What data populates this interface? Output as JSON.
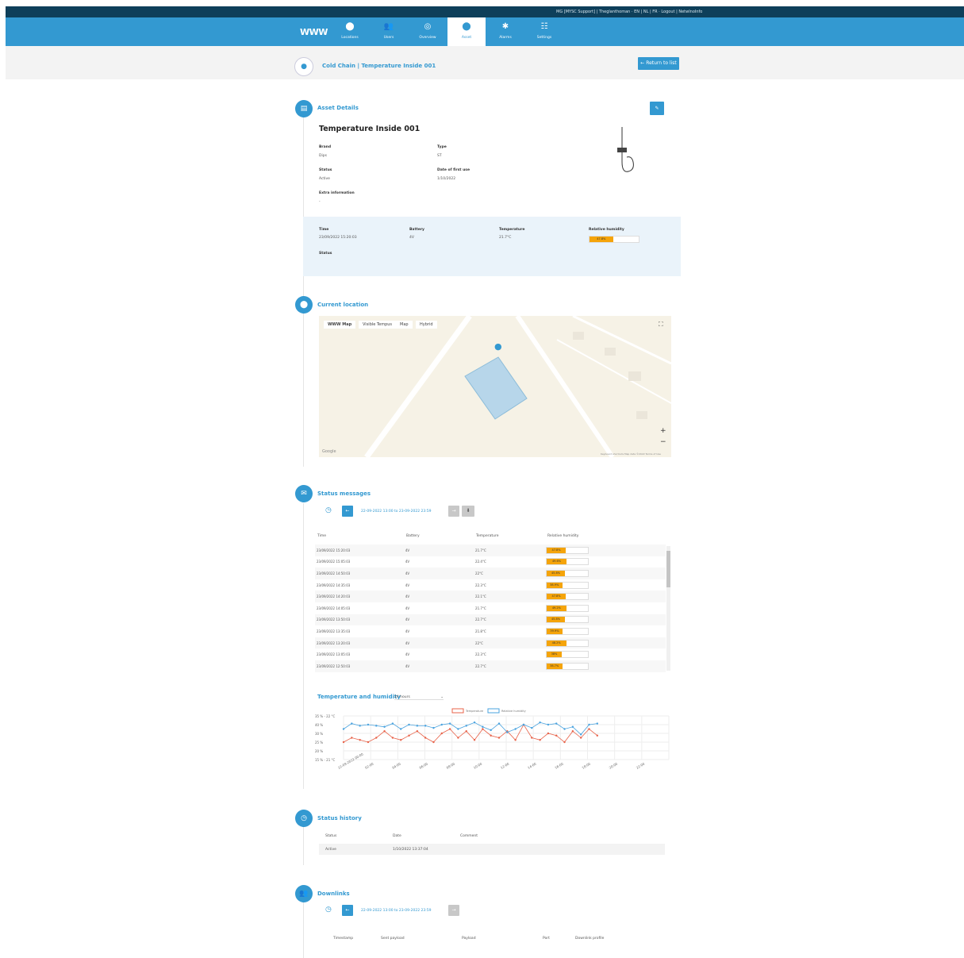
{
  "topbar": {
    "user_text": "MG [MYSC Support] | Theglanthoman · EN | NL | FR · Logout | NetwInoInfo"
  },
  "nav": {
    "logo": "WWW",
    "items": [
      {
        "label": "Locations",
        "icon": "map-pin-icon"
      },
      {
        "label": "Users",
        "icon": "users-icon"
      },
      {
        "label": "Overview",
        "icon": "eye-icon"
      },
      {
        "label": "Asset",
        "icon": "asset-pin-icon",
        "active": true
      },
      {
        "label": "Alarms",
        "icon": "alarm-icon"
      },
      {
        "label": "Settings",
        "icon": "settings-icon"
      }
    ]
  },
  "title": {
    "text": "Cold Chain | Temperature Inside 001",
    "return_label": "Return to list"
  },
  "asset_details": {
    "section_title": "Asset Details",
    "name": "Temperature Inside 001",
    "brand_label": "Brand",
    "brand_value": "Dips",
    "type_label": "Type",
    "type_value": "ST",
    "status_label": "Status",
    "status_value": "Active",
    "last_status_label": "Date of first use",
    "last_status_value": "1/10/2022",
    "extra_label": "Extra information",
    "extra_value": "-",
    "latest": {
      "time_label": "Time",
      "time_value": "23/09/2022 15:20:03",
      "battery_label": "Battery",
      "battery_value": "4V",
      "temp_label": "Temperature",
      "temp_value": "21.7°C",
      "humidity_label": "Relative humidity",
      "humidity_value": "47.8%",
      "humidity_fraction": 0.478,
      "status_label": "Status"
    }
  },
  "location": {
    "section_title": "Current location",
    "tabs": [
      "WWW Map",
      "Visible Tempus",
      "Map",
      "Hybrid"
    ],
    "google_label": "Google",
    "footer_text": "Keyboard shortcuts  Map data ©2022  Terms of Use"
  },
  "status_messages": {
    "section_title": "Status messages",
    "date_range": "22-09-2022 13:00 to 23-09-2022 23:59",
    "columns": [
      "Time",
      "Battery",
      "Temperature",
      "Relative humidity"
    ],
    "rows": [
      {
        "time": "23/09/2022 15:20:03",
        "battery": "4V",
        "temp": "21.7°C",
        "hum": "47.8%",
        "frac": 0.478
      },
      {
        "time": "23/09/2022 15:05:03",
        "battery": "4V",
        "temp": "22.4°C",
        "hum": "49.6%",
        "frac": 0.496
      },
      {
        "time": "23/09/2022 14:50:03",
        "battery": "4V",
        "temp": "22°C",
        "hum": "45.8%",
        "frac": 0.458
      },
      {
        "time": "23/09/2022 14:35:03",
        "battery": "4V",
        "temp": "22.3°C",
        "hum": "38.9%",
        "frac": 0.389
      },
      {
        "time": "23/09/2022 14:20:03",
        "battery": "4V",
        "temp": "22.1°C",
        "hum": "47.8%",
        "frac": 0.478
      },
      {
        "time": "23/09/2022 14:05:03",
        "battery": "4V",
        "temp": "21.7°C",
        "hum": "49.2%",
        "frac": 0.492
      },
      {
        "time": "23/09/2022 13:50:03",
        "battery": "4V",
        "temp": "22.7°C",
        "hum": "45.8%",
        "frac": 0.458
      },
      {
        "time": "23/09/2022 13:35:03",
        "battery": "4V",
        "temp": "21.8°C",
        "hum": "39.9%",
        "frac": 0.399
      },
      {
        "time": "23/09/2022 13:20:03",
        "battery": "4V",
        "temp": "22°C",
        "hum": "48.2%",
        "frac": 0.482
      },
      {
        "time": "23/09/2022 13:05:03",
        "battery": "4V",
        "temp": "22.3°C",
        "hum": "38%",
        "frac": 0.38
      },
      {
        "time": "23/09/2022 12:50:03",
        "battery": "4V",
        "temp": "22.7°C",
        "hum": "38.7%",
        "frac": 0.387
      }
    ]
  },
  "chart_section": {
    "title": "Temperature and humidity",
    "range_select": "24 hours"
  },
  "chart_data": {
    "type": "line",
    "title": "Temperature and humidity",
    "x": [
      "22-09-2022 00:00",
      "02:00",
      "04:00",
      "06:00",
      "08:00",
      "10:00",
      "12:00",
      "14:00",
      "16:00",
      "18:00",
      "20:00",
      "22:00"
    ],
    "series": [
      {
        "name": "Temperature",
        "color": "#e8634a",
        "values": [
          21.8,
          22.0,
          21.9,
          21.8,
          22.0,
          22.3,
          22.0,
          21.9,
          22.1,
          22.3,
          22.0,
          21.8,
          22.2,
          22.4,
          22.0,
          22.3,
          21.9,
          22.4,
          22.1,
          22.0,
          22.3,
          21.9,
          22.6,
          22.0,
          21.9,
          22.2,
          22.1,
          21.8,
          22.3,
          22.0,
          22.4,
          22.1
        ]
      },
      {
        "name": "Relative humidity",
        "color": "#4aa3df",
        "values": [
          43,
          48,
          46,
          47,
          46,
          45,
          48,
          43,
          47,
          46,
          46,
          44,
          47,
          48,
          43,
          46,
          49,
          45,
          42,
          48,
          40,
          43,
          47,
          44,
          49,
          47,
          48,
          43,
          45,
          38,
          47,
          48
        ]
      }
    ],
    "y_ticks_left": [
      "35 % - 22 °C",
      "40 %",
      "30 %",
      "25 %",
      "20 %",
      "15 % - 21 °C"
    ],
    "legend": "top-center"
  },
  "status_history": {
    "section_title": "Status history",
    "columns": [
      "Status",
      "Date",
      "Comment"
    ],
    "rows": [
      {
        "status": "Active",
        "date": "1/10/2022 13:37:04",
        "comment": ""
      }
    ]
  },
  "downlinks": {
    "section_title": "Downlinks",
    "date_range": "22-09-2022 13:00 to 23-09-2022 23:59",
    "columns": [
      "Timestamp",
      "Sent payload",
      "Payload",
      "Port",
      "Downlink profile"
    ]
  }
}
